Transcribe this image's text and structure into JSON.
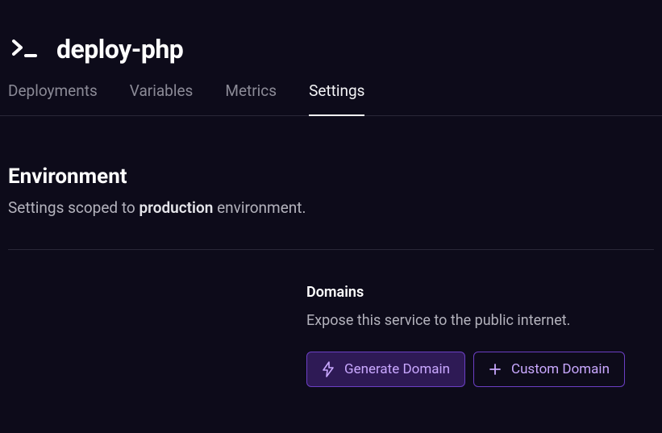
{
  "header": {
    "title": "deploy-php"
  },
  "tabs": [
    {
      "label": "Deployments",
      "active": false
    },
    {
      "label": "Variables",
      "active": false
    },
    {
      "label": "Metrics",
      "active": false
    },
    {
      "label": "Settings",
      "active": true
    }
  ],
  "environment": {
    "title": "Environment",
    "subtitle_prefix": "Settings scoped to ",
    "subtitle_env": "production",
    "subtitle_suffix": " environment."
  },
  "domains": {
    "title": "Domains",
    "description": "Expose this service to the public internet.",
    "generate_button": "Generate Domain",
    "custom_button": "Custom Domain"
  }
}
